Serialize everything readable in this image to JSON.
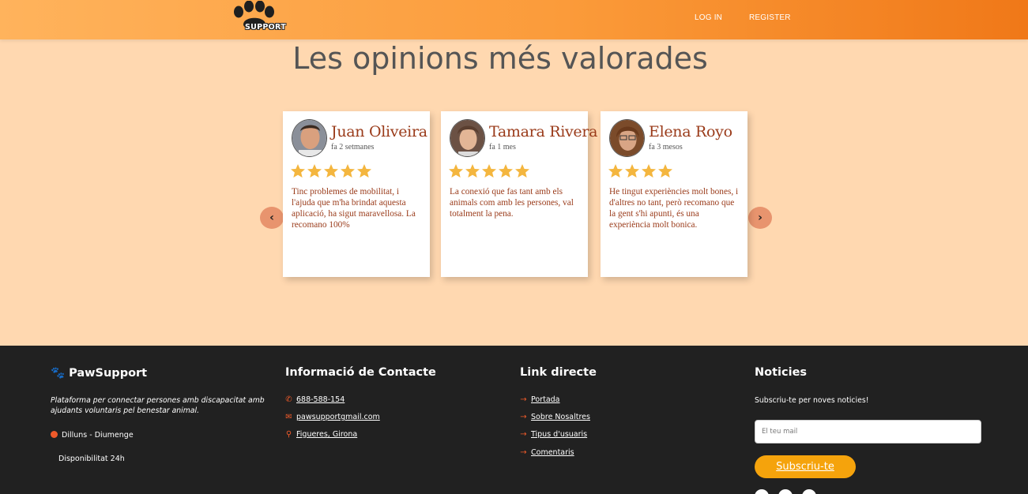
{
  "header": {
    "logo_text": "SUPPORT",
    "nav": {
      "login": "LOG IN",
      "register": "REGISTER"
    }
  },
  "section": {
    "title": "Les opinions més valorades"
  },
  "reviews": [
    {
      "name": "Juan Oliveira",
      "time": "fa 2 setmanes",
      "rating": 5,
      "text": "Tinc problemes de mobilitat, i l'ajuda que m'ha brindat aquesta aplicació, ha sigut maravellosa. La recomano 100%"
    },
    {
      "name": "Tamara Rivera",
      "time": "fa 1 mes",
      "rating": 5,
      "text": "La conexió que fas tant amb els animals com amb les persones, val totalment la pena."
    },
    {
      "name": "Elena Royo",
      "time": "fa 3 mesos",
      "rating": 4,
      "text": "He tingut experiències molt bones, i d'altres no tant, però recomano que la gent s'hi apunti, és una experiència molt bonica."
    }
  ],
  "carousel": {
    "prev_icon": "chevron-left-icon",
    "next_icon": "chevron-right-icon"
  },
  "footer": {
    "brand": {
      "title": "PawSupport",
      "description": "Plataforma per connectar persones amb discapacitat amb ajudants voluntaris pel benestar animal.",
      "days": "Dilluns - Diumenge",
      "availability": "Disponibilitat 24h"
    },
    "contact": {
      "title": "Informació de Contacte",
      "phone": "688-588-154",
      "email": "pawsupportgmail.com",
      "location": "Figueres, Girona"
    },
    "links": {
      "title": "Link directe",
      "items": [
        "Portada",
        "Sobre Nosaltres",
        "Tipus d'usuaris",
        "Comentaris"
      ]
    },
    "news": {
      "title": "Noticies",
      "subtitle": "Subscriu-te per noves noticies!",
      "placeholder": "El teu mail",
      "button": "Subscriu-te"
    }
  },
  "colors": {
    "accent": "#ef5a2a",
    "header_start": "#ffb35c",
    "header_end": "#f07818",
    "star": "#f4b63f",
    "button": "#f5a30c"
  }
}
